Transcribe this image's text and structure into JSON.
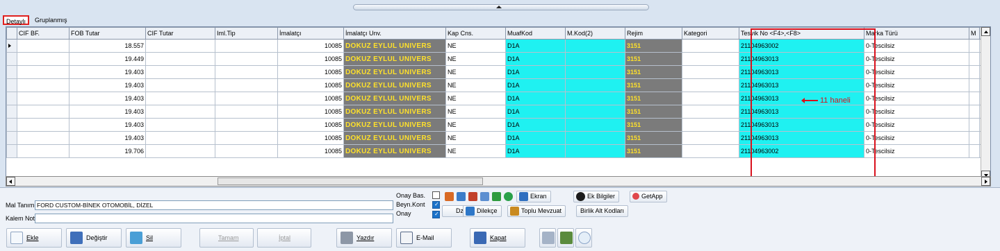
{
  "tabs": {
    "detay": "Detaylı",
    "grup": "Gruplanmış"
  },
  "grid": {
    "columns": [
      "CIF BF.",
      "FOB Tutar",
      "CIF Tutar",
      "Iml.Tip",
      "İmalatçı",
      "İmalatçı Unv.",
      "Kap Cns.",
      "MuafKod",
      "M.Kod(2)",
      "Rejim",
      "Kategori",
      "Tesvik No <F4>,<F8>",
      "Marka Türü",
      "M"
    ],
    "rows": [
      {
        "fob": "18.557",
        "imalatci": "10085",
        "unv": "DOKUZ EYLUL UNIVERS",
        "kap": "NE",
        "muaf": "D1A",
        "rejim": "3151",
        "tesvik": "21104963002",
        "marka": "0-Tescilsiz"
      },
      {
        "fob": "19.449",
        "imalatci": "10085",
        "unv": "DOKUZ EYLUL UNIVERS",
        "kap": "NE",
        "muaf": "D1A",
        "rejim": "3151",
        "tesvik": "21104963013",
        "marka": "0-Tescilsiz"
      },
      {
        "fob": "19.403",
        "imalatci": "10085",
        "unv": "DOKUZ EYLUL UNIVERS",
        "kap": "NE",
        "muaf": "D1A",
        "rejim": "3151",
        "tesvik": "21104963013",
        "marka": "0-Tescilsiz"
      },
      {
        "fob": "19.403",
        "imalatci": "10085",
        "unv": "DOKUZ EYLUL UNIVERS",
        "kap": "NE",
        "muaf": "D1A",
        "rejim": "3151",
        "tesvik": "21104963013",
        "marka": "0-Tescilsiz"
      },
      {
        "fob": "19.403",
        "imalatci": "10085",
        "unv": "DOKUZ EYLUL UNIVERS",
        "kap": "NE",
        "muaf": "D1A",
        "rejim": "3151",
        "tesvik": "21104963013",
        "marka": "0-Tescilsiz"
      },
      {
        "fob": "19.403",
        "imalatci": "10085",
        "unv": "DOKUZ EYLUL UNIVERS",
        "kap": "NE",
        "muaf": "D1A",
        "rejim": "3151",
        "tesvik": "21104963013",
        "marka": "0-Tescilsiz"
      },
      {
        "fob": "19.403",
        "imalatci": "10085",
        "unv": "DOKUZ EYLUL UNIVERS",
        "kap": "NE",
        "muaf": "D1A",
        "rejim": "3151",
        "tesvik": "21104963013",
        "marka": "0-Tescilsiz"
      },
      {
        "fob": "19.403",
        "imalatci": "10085",
        "unv": "DOKUZ EYLUL UNIVERS",
        "kap": "NE",
        "muaf": "D1A",
        "rejim": "3151",
        "tesvik": "21104963013",
        "marka": "0-Tescilsiz"
      },
      {
        "fob": "19.706",
        "imalatci": "10085",
        "unv": "DOKUZ EYLUL UNIVERS",
        "kap": "NE",
        "muaf": "D1A",
        "rejim": "3151",
        "tesvik": "21104963002",
        "marka": "0-Tescilsiz"
      }
    ],
    "annotation": "11 haneli"
  },
  "form": {
    "mal_tanimi_label": "Mal Tanımı",
    "mal_tanimi_value": "FORD CUSTOM-BİNEK OTOMOBİL, DİZEL",
    "kalem_not_label": "Kalem Not",
    "kalem_not_value": "",
    "onay_bas": "Onay Bas.",
    "beyn_kont": "Beyn.Kont",
    "onay": "Onay"
  },
  "toolbar": {
    "ekran": "Ekran",
    "ek_bilgiler": "Ek Bilgiler",
    "getapp": "GetApp",
    "dzlt": "Dzlt",
    "dilekce": "Dilekçe",
    "toplu_mevzuat": "Toplu Mevzuat",
    "birlik_alt_kodlari": "Birlik Alt Kodları"
  },
  "buttons": {
    "ekle": "Ekle",
    "degistir": "Değiştir",
    "sil": "Sil",
    "tamam": "Tamam",
    "iptal": "İptal",
    "yazdir": "Yazdır",
    "email": "E-Mail",
    "kapat": "Kapat"
  }
}
